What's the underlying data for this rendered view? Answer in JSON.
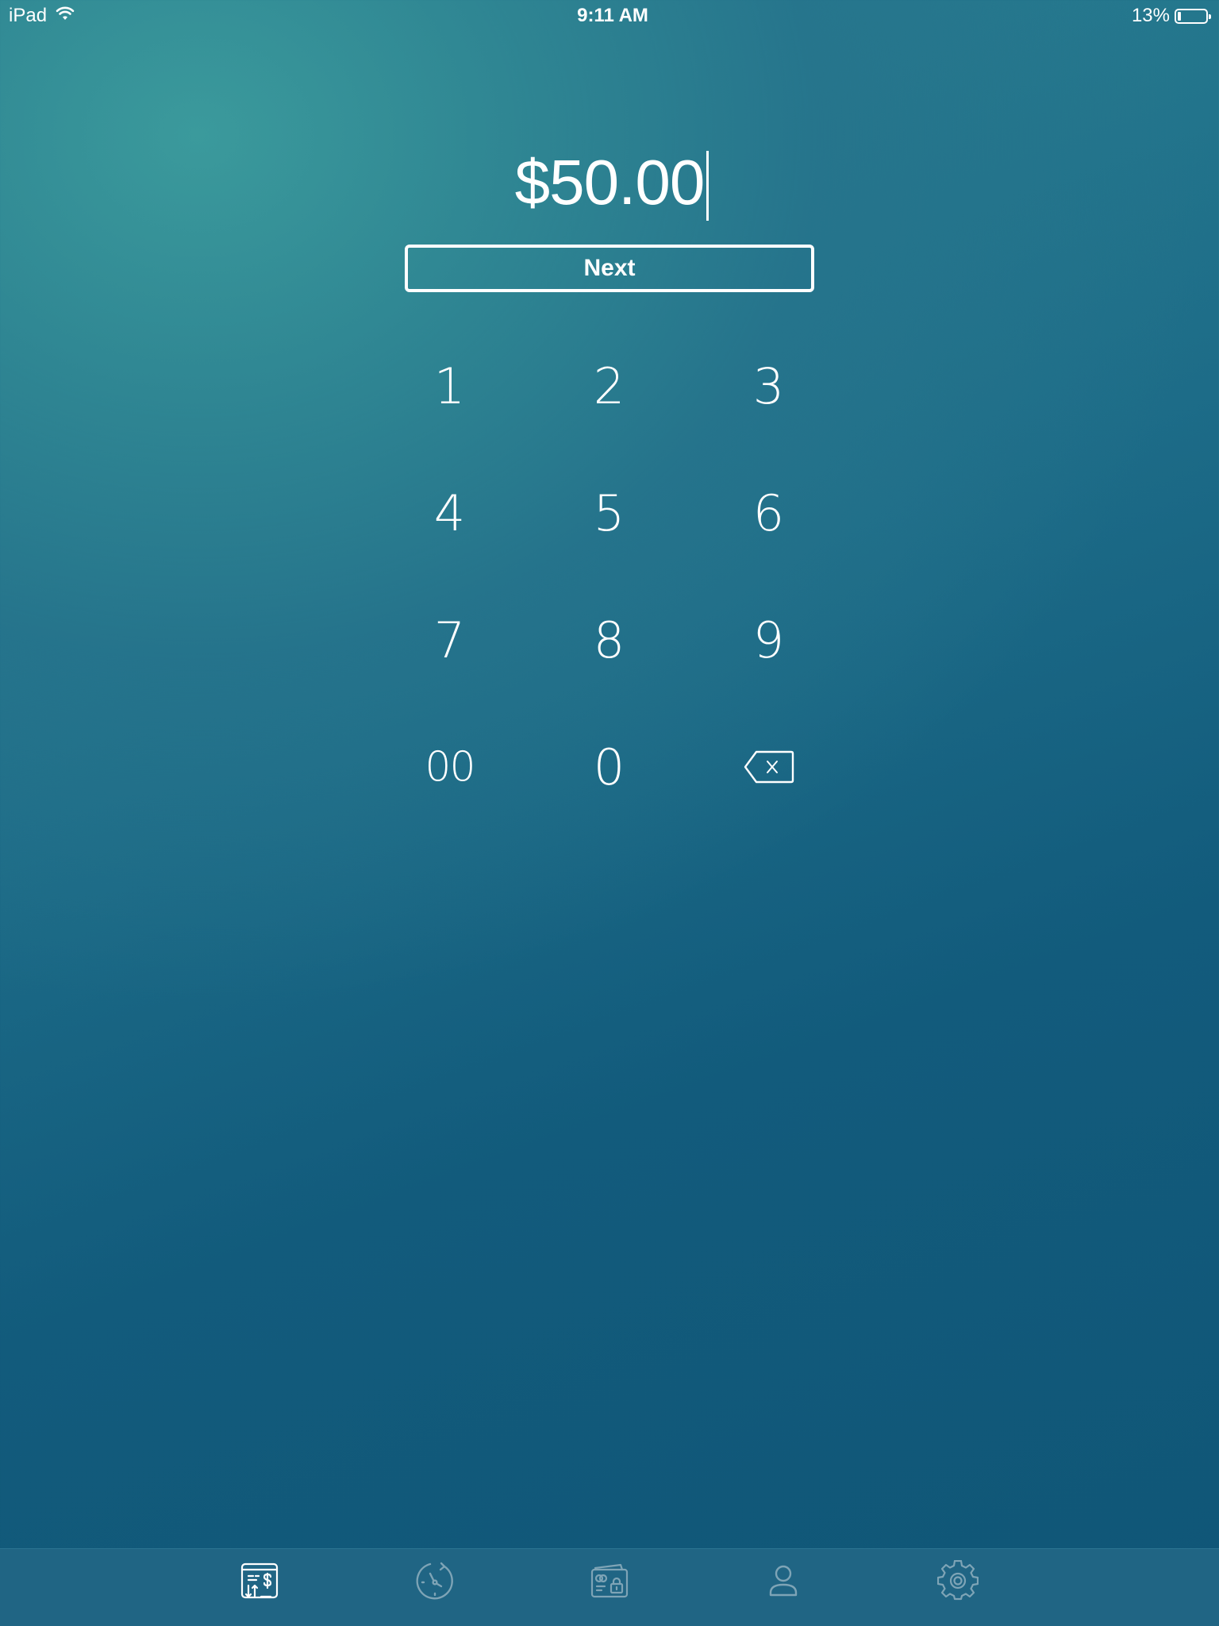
{
  "status_bar": {
    "device": "iPad",
    "time": "9:11 AM",
    "battery_percent_label": "13%",
    "battery_level": 0.13
  },
  "amount": {
    "value": "$50.00"
  },
  "next_button": {
    "label": "Next"
  },
  "keypad": {
    "keys": [
      "1",
      "2",
      "3",
      "4",
      "5",
      "6",
      "7",
      "8",
      "9",
      "00",
      "0"
    ],
    "backspace_icon": "backspace-icon"
  },
  "tab_bar": {
    "tabs": [
      {
        "icon": "transactions-icon",
        "active": true
      },
      {
        "icon": "history-icon",
        "active": false
      },
      {
        "icon": "wallet-lock-icon",
        "active": false
      },
      {
        "icon": "user-icon",
        "active": false
      },
      {
        "icon": "gear-icon",
        "active": false
      }
    ]
  },
  "colors": {
    "gradient_light": "#3b9a9c",
    "gradient_dark": "#105677",
    "tab_bar_bg": "#206584",
    "active_icon": "#ffffff",
    "inactive_icon": "#7ea4b6"
  }
}
